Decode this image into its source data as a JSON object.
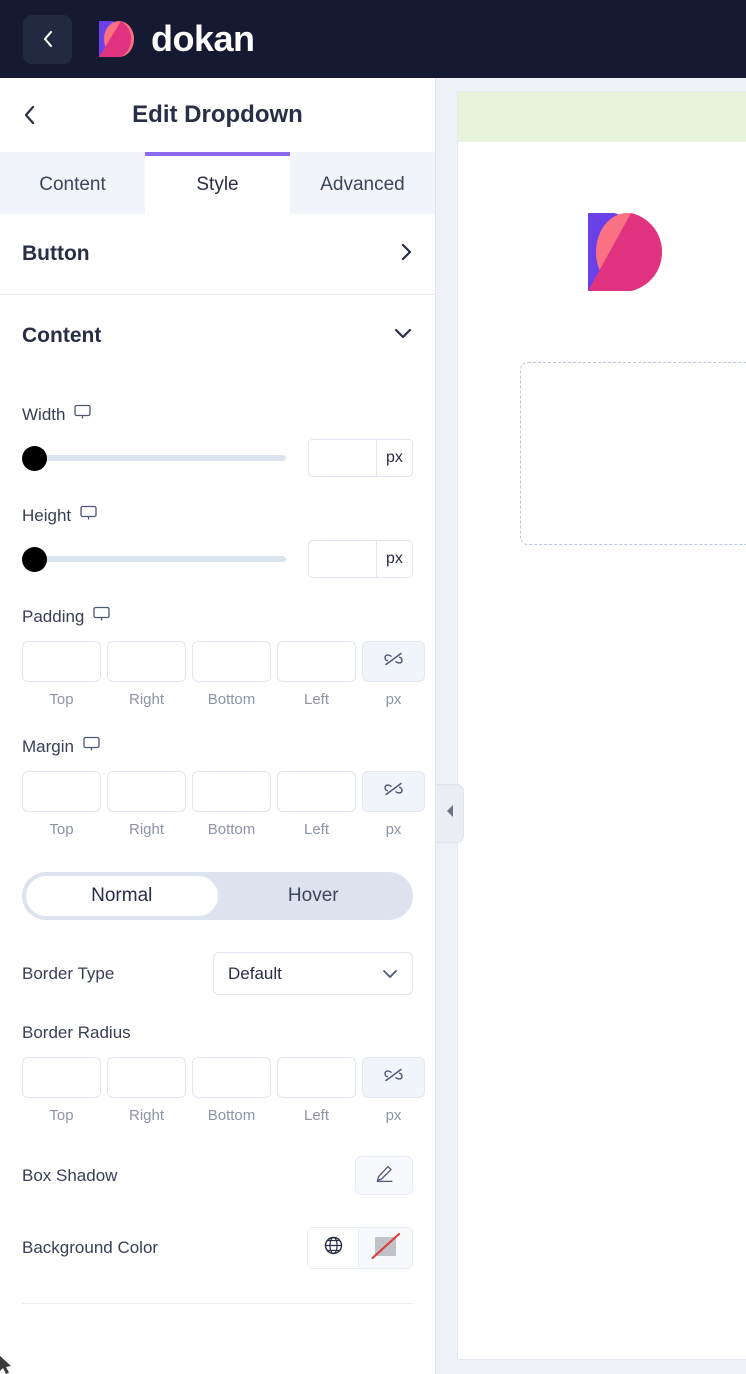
{
  "topbar": {
    "back_icon": "chevron-left-icon",
    "brand_name": "dokan",
    "logo_icon": "dokan-logo-mark"
  },
  "panel": {
    "back_icon": "chevron-left-icon",
    "title": "Edit Dropdown",
    "tabs": [
      {
        "label": "Content",
        "active": false
      },
      {
        "label": "Style",
        "active": true
      },
      {
        "label": "Advanced",
        "active": false
      }
    ],
    "sections": [
      {
        "title": "Button",
        "expanded": false,
        "chevron": "chevron-right-icon"
      },
      {
        "title": "Content",
        "expanded": true,
        "chevron": "chevron-down-icon"
      }
    ],
    "content_section": {
      "width": {
        "label": "Width",
        "device_icon": "monitor-icon",
        "value": "",
        "unit": "px",
        "slider_percent": 0
      },
      "height": {
        "label": "Height",
        "device_icon": "monitor-icon",
        "value": "",
        "unit": "px",
        "slider_percent": 0
      },
      "padding": {
        "label": "Padding",
        "device_icon": "monitor-icon",
        "unit": "px",
        "link_icon": "unlink-icon",
        "fields": [
          {
            "caption": "Top",
            "value": ""
          },
          {
            "caption": "Right",
            "value": ""
          },
          {
            "caption": "Bottom",
            "value": ""
          },
          {
            "caption": "Left",
            "value": ""
          }
        ]
      },
      "margin": {
        "label": "Margin",
        "device_icon": "monitor-icon",
        "unit": "px",
        "link_icon": "unlink-icon",
        "fields": [
          {
            "caption": "Top",
            "value": ""
          },
          {
            "caption": "Right",
            "value": ""
          },
          {
            "caption": "Bottom",
            "value": ""
          },
          {
            "caption": "Left",
            "value": ""
          }
        ]
      },
      "state_toggle": {
        "options": [
          {
            "label": "Normal",
            "active": true
          },
          {
            "label": "Hover",
            "active": false
          }
        ]
      },
      "border_type": {
        "label": "Border Type",
        "value": "Default",
        "chevron": "chevron-down-icon"
      },
      "border_radius": {
        "label": "Border Radius",
        "unit": "px",
        "link_icon": "unlink-icon",
        "fields": [
          {
            "caption": "Top",
            "value": ""
          },
          {
            "caption": "Right",
            "value": ""
          },
          {
            "caption": "Bottom",
            "value": ""
          },
          {
            "caption": "Left",
            "value": ""
          }
        ]
      },
      "box_shadow": {
        "label": "Box Shadow",
        "edit_icon": "pencil-icon"
      },
      "background_color": {
        "label": "Background Color",
        "global_icon": "globe-icon",
        "swatch_icon": "no-color-swatch-icon"
      }
    }
  },
  "preview": {
    "banner_color": "#e9f2dc",
    "logo_icon": "dokan-logo-mark",
    "placeholder_icon": "dashed-placeholder-box"
  },
  "collapse_handle": {
    "icon": "triangle-left-icon"
  },
  "colors": {
    "accent_purple": "#8a6bef",
    "header_navy": "#151a32",
    "text_dark": "#272e45",
    "muted": "#8b93a7",
    "border": "#dfe4ee",
    "panel_bg": "#eef1f7",
    "logo_purple": "#6a40e8",
    "logo_pink": "#e0337f",
    "logo_coral": "#fa7184"
  }
}
